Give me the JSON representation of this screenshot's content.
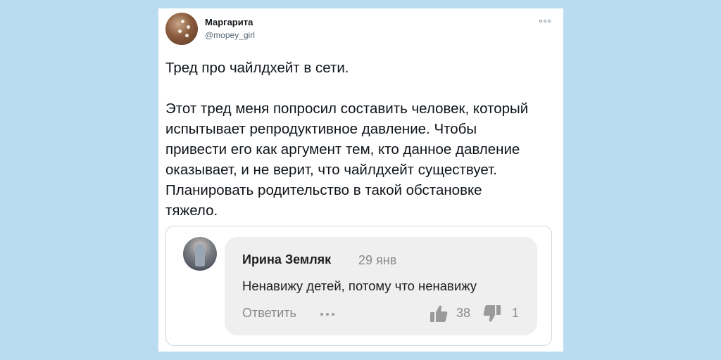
{
  "tweet": {
    "author_name": "Маргарита",
    "author_handle": "@mopey_girl",
    "paragraph_1": "Тред про чайлдхейт в сети.",
    "paragraph_2_lines": [
      "Этот тред меня попросил составить человек, который",
      "испытывает репродуктивное давление. Чтобы",
      "привести его как аргумент тем, кто данное давление",
      "оказывает, и не верит, что чайлдхейт существует.",
      "Планировать родительство в такой обстановке",
      "тяжело."
    ],
    "more_icon": "more-options-icon"
  },
  "comment": {
    "author_name": "Ирина Земляк",
    "date": "29 янв",
    "text": "Ненавижу детей, потому что ненавижу",
    "reply_label": "Ответить",
    "likes": "38",
    "dislikes": "1",
    "like_icon": "thumbs-up-icon",
    "dislike_icon": "thumbs-down-icon"
  },
  "colors": {
    "background": "#b9dcf2",
    "card": "#ffffff",
    "comment_bubble": "#efefef",
    "muted_text": "#8a8a8a"
  }
}
